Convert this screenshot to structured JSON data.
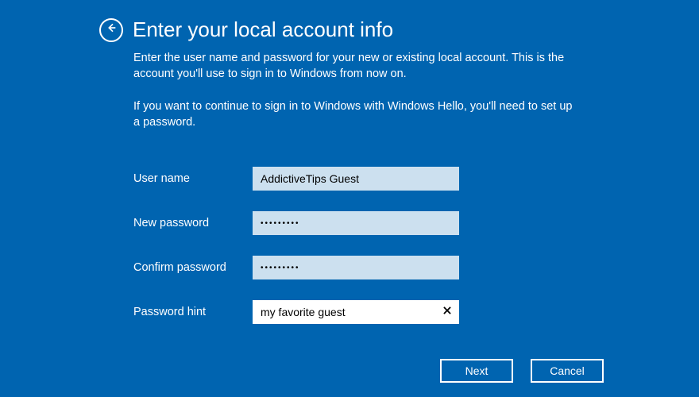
{
  "header": {
    "title": "Enter your local account info"
  },
  "body": {
    "description1": "Enter the user name and password for your new or existing local account. This is the account you'll use to sign in to Windows from now on.",
    "description2": "If you want to continue to sign in to Windows with Windows Hello, you'll need to set up a password."
  },
  "form": {
    "username_label": "User name",
    "username_value": "AddictiveTips Guest",
    "new_password_label": "New password",
    "new_password_value": "•••••••••",
    "confirm_password_label": "Confirm password",
    "confirm_password_value": "•••••••••",
    "hint_label": "Password hint",
    "hint_value": "my favorite guest"
  },
  "buttons": {
    "next": "Next",
    "cancel": "Cancel"
  }
}
